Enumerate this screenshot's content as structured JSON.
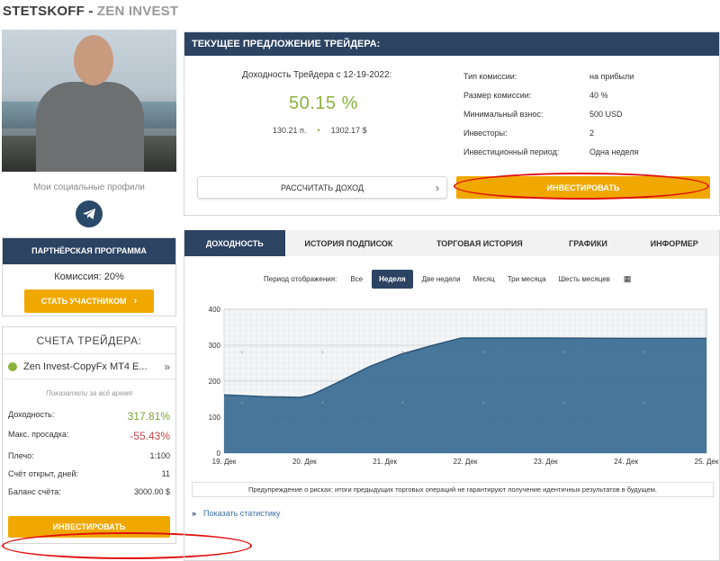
{
  "brand": {
    "name": "STETSKOFF",
    "sep": " - ",
    "sub": "ZEN INVEST"
  },
  "left": {
    "social_label": "Мои социальные профили",
    "partner": {
      "title": "ПАРТНЁРСКАЯ ПРОГРАММА",
      "commission": "Комиссия: 20%",
      "button": "СТАТЬ УЧАСТНИКОМ",
      "chevron": "›"
    },
    "accounts": {
      "title": "СЧЕТА ТРЕЙДЕРА:",
      "account_name": "Zen Invest-CopyFx MT4 E...",
      "arrow": "»",
      "caption": "Показатели за всё время",
      "stats": [
        {
          "label": "Доходность:",
          "value": "317.81%"
        },
        {
          "label": "Макс. просадка:",
          "value": "-55.43%"
        },
        {
          "label": "Плечо:",
          "value": "1:100"
        },
        {
          "label": "Счёт открыт, дней:",
          "value": "11"
        },
        {
          "label": "Баланс счёта:",
          "value": "3000.00 $"
        }
      ],
      "invest_button": "ИНВЕСТИРОВАТЬ"
    }
  },
  "offer": {
    "header": "ТЕКУЩЕЕ ПРЕДЛОЖЕНИЕ ТРЕЙДЕРА:",
    "profit_title": "Доходность Трейдера с 12-19-2022:",
    "profit_value": "50.15 %",
    "points": "130.21 п.",
    "bullet": "•",
    "amount": "1302.17 $",
    "calc_button": "РАССЧИТАТЬ ДОХОД",
    "calc_chevron": "›",
    "invest_button": "ИНВЕСТИРОВАТЬ",
    "details": [
      {
        "label": "Тип комиссии:",
        "value": "на прибыли"
      },
      {
        "label": "Размер комиссии:",
        "value": "40 %"
      },
      {
        "label": "Минимальный взнос:",
        "value": "500 USD"
      },
      {
        "label": "Инвесторы:",
        "value": "2"
      },
      {
        "label": "Инвестиционный период:",
        "value": "Одна неделя"
      }
    ]
  },
  "tabs": [
    {
      "label": "ДОХОДНОСТЬ",
      "active": true
    },
    {
      "label": "ИСТОРИЯ ПОДПИСОК"
    },
    {
      "label": "ТОРГОВАЯ ИСТОРИЯ"
    },
    {
      "label": "ГРАФИКИ"
    },
    {
      "label": "ИНФОРМЕР"
    }
  ],
  "period": {
    "label": "Период отображения:",
    "options": [
      "Все",
      "Неделя",
      "Две недели",
      "Месяц",
      "Три месяца",
      "Шесть месяцев"
    ],
    "active": "Неделя",
    "calendar_icon": "calendar-icon"
  },
  "chart_data": {
    "type": "area",
    "x": [
      "19. Дек",
      "20. Дек",
      "21. Дек",
      "22. Дек",
      "23. Дек",
      "24. Дек",
      "25. Дек"
    ],
    "series": [
      {
        "values": [
          [
            0,
            162
          ],
          [
            0.5,
            157
          ],
          [
            0.95,
            155
          ],
          [
            1.1,
            163
          ],
          [
            1.4,
            195
          ],
          [
            1.8,
            240
          ],
          [
            2.2,
            275
          ],
          [
            2.6,
            300
          ],
          [
            2.95,
            320
          ],
          [
            3.5,
            320
          ],
          [
            4,
            320
          ],
          [
            5,
            319
          ],
          [
            6,
            319
          ]
        ]
      }
    ],
    "y_ticks": [
      0,
      100,
      200,
      300,
      400
    ],
    "ylim": [
      0,
      400
    ],
    "grid": true,
    "color": "#3d6f95"
  },
  "warning": "Предупреждение о рисках: итоги предыдущих торговых операций не гарантируют получение идентичных результатов в будущем.",
  "show_stats": {
    "icon": "»",
    "label": "Показать статистику"
  },
  "colors": {
    "navy": "#2c4362",
    "accent_green": "#8ab23c",
    "button_yellow": "#f0a800",
    "danger": "#c24b4b",
    "chart_fill": "#3d6f95"
  }
}
